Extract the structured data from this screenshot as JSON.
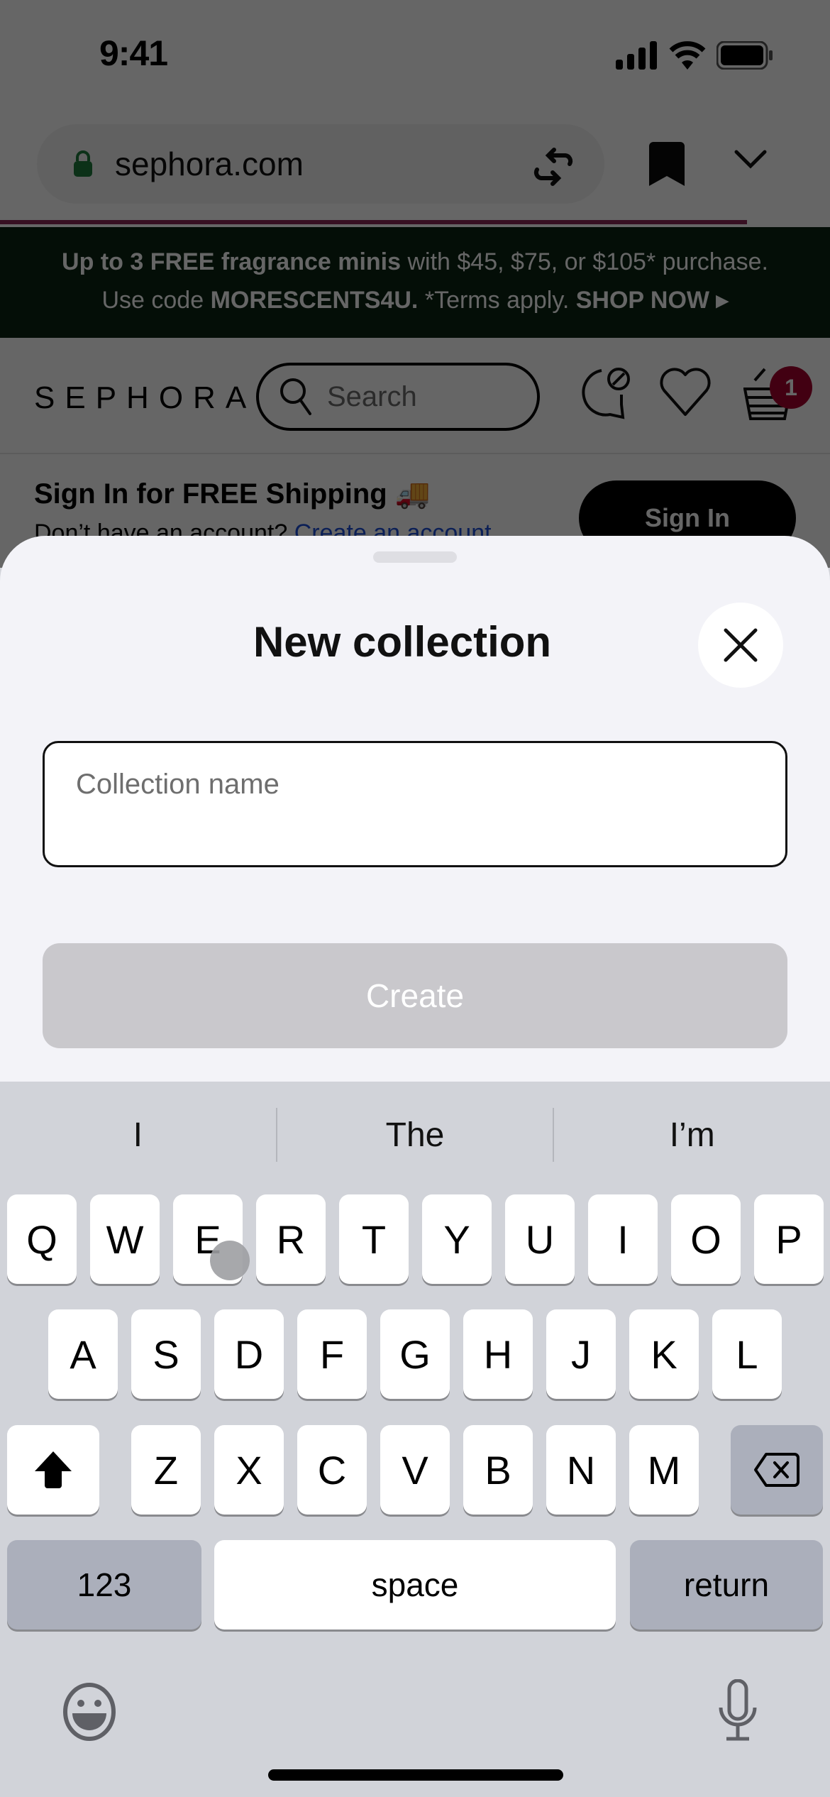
{
  "status_bar": {
    "time": "9:41",
    "icons": [
      "cellular-signal-icon",
      "wifi-icon",
      "battery-icon"
    ]
  },
  "browser": {
    "url": "sephora.com",
    "lock_icon": "lock-icon",
    "actions": [
      "tabs-switch-icon",
      "bookmark-icon",
      "chevron-down-icon"
    ],
    "progress_fraction": 0.9,
    "progress_color": "#8a2a55"
  },
  "promo": {
    "line1_bold": "Up to 3 FREE fragrance minis",
    "line1_rest": " with $45, $75, or $105* purchase.",
    "line2_prefix": "Use code ",
    "code": "MORESCENTS4U.",
    "terms": " *Terms apply. ",
    "cta": "SHOP NOW ▸",
    "background": "#0a2313"
  },
  "site_header": {
    "logo": "SEPHORA",
    "search_placeholder": "Search",
    "icons": [
      "chat-icon",
      "heart-icon",
      "basket-icon"
    ],
    "basket_count": "1",
    "badge_color": "#a5002e"
  },
  "signin_banner": {
    "title": "Sign In for FREE Shipping 🚚",
    "subtitle": "Don’t have an account? ",
    "link": "Create an account",
    "button": "Sign In"
  },
  "sheet": {
    "title": "New collection",
    "input_placeholder": "Collection name",
    "input_value": "",
    "create_label": "Create",
    "create_enabled": false
  },
  "keyboard": {
    "suggestions": [
      "I",
      "The",
      "I’m"
    ],
    "row1": [
      "Q",
      "W",
      "E",
      "R",
      "T",
      "Y",
      "U",
      "I",
      "O",
      "P"
    ],
    "row2": [
      "A",
      "S",
      "D",
      "F",
      "G",
      "H",
      "J",
      "K",
      "L"
    ],
    "row3": [
      "Z",
      "X",
      "C",
      "V",
      "B",
      "N",
      "M"
    ],
    "numbers_label": "123",
    "space_label": "space",
    "return_label": "return",
    "shift_icon": "shift-icon",
    "delete_icon": "backspace-icon",
    "emoji_icon": "emoji-icon",
    "mic_icon": "microphone-icon"
  }
}
